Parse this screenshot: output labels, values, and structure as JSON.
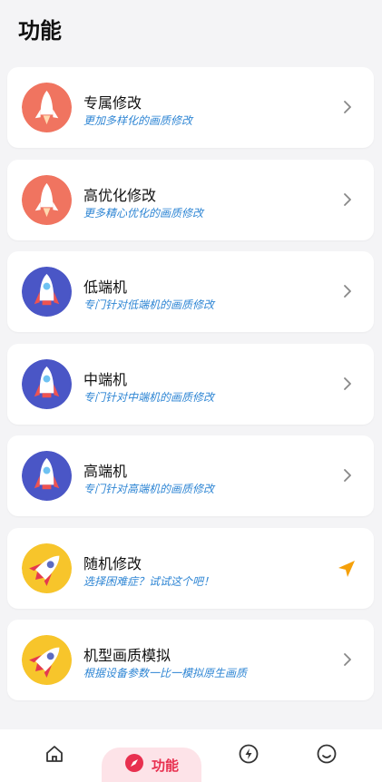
{
  "header": {
    "title": "功能"
  },
  "items": [
    {
      "title": "专属修改",
      "subtitle": "更加多样化的画质修改",
      "icon": "red-rocket-icon",
      "action": "chevron-right-icon"
    },
    {
      "title": "高优化修改",
      "subtitle": "更多精心优化的画质修改",
      "icon": "red-rocket-icon",
      "action": "chevron-right-icon"
    },
    {
      "title": "低端机",
      "subtitle": "专门针对低端机的画质修改",
      "icon": "blue-rocket-icon",
      "action": "chevron-right-icon"
    },
    {
      "title": "中端机",
      "subtitle": "专门针对中端机的画质修改",
      "icon": "blue-rocket-icon",
      "action": "chevron-right-icon"
    },
    {
      "title": "高端机",
      "subtitle": "专门针对高端机的画质修改",
      "icon": "blue-rocket-icon",
      "action": "chevron-right-icon"
    },
    {
      "title": "随机修改",
      "subtitle": "选择困难症？试试这个吧！",
      "icon": "yellow-rocket-icon",
      "action": "send-arrow-icon"
    },
    {
      "title": "机型画质模拟",
      "subtitle": "根据设备参数一比一模拟原生画质",
      "icon": "yellow-rocket-icon",
      "action": "chevron-right-icon"
    }
  ],
  "nav": {
    "items": [
      {
        "name": "home",
        "icon": "home-icon"
      },
      {
        "name": "features",
        "icon": "compass-icon",
        "label": "功能",
        "active": true
      },
      {
        "name": "boost",
        "icon": "lightning-icon"
      },
      {
        "name": "profile",
        "icon": "smiley-icon"
      }
    ]
  },
  "colors": {
    "accent": "#e8304f",
    "subtitle": "#2f86d4",
    "active_bg": "#fde3e8"
  }
}
